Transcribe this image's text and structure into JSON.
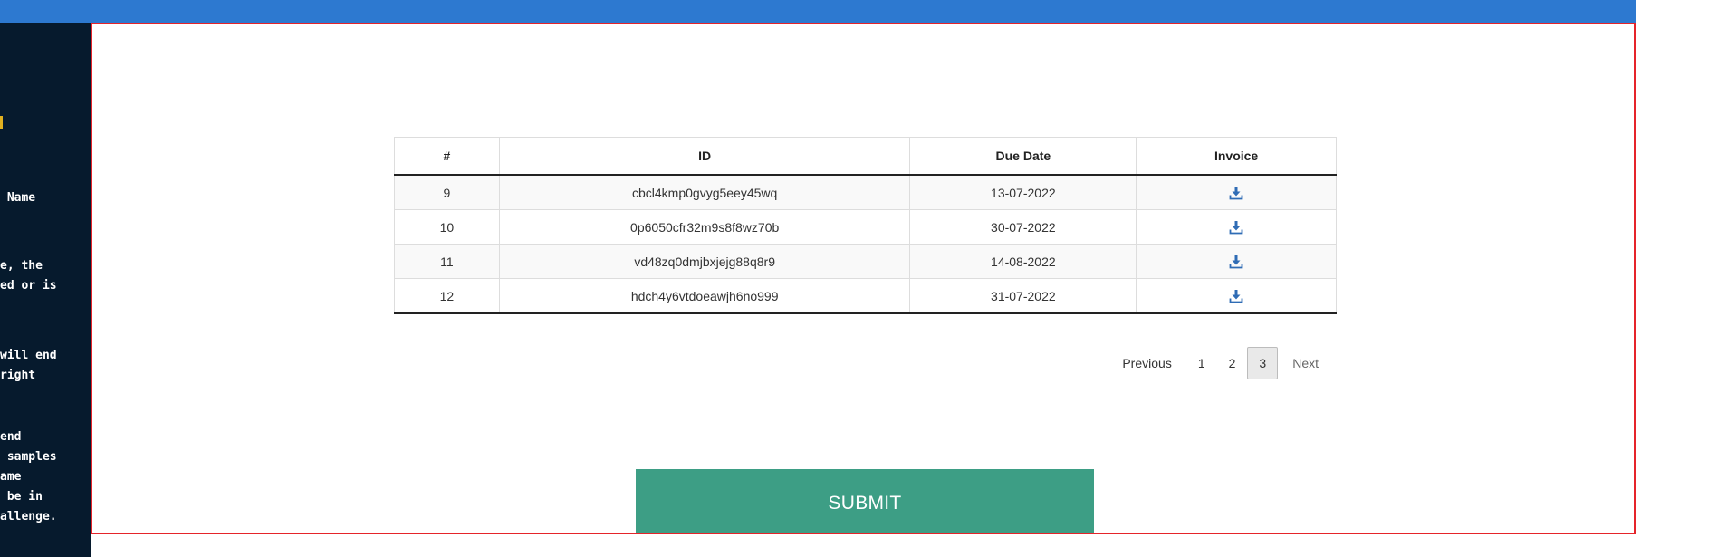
{
  "left_panel": {
    "lines": [
      " Name",
      "e, the",
      "ed or is",
      "will end",
      "right",
      "end",
      " samples",
      "ame",
      " be in",
      "allenge."
    ]
  },
  "table": {
    "headers": [
      "#",
      "ID",
      "Due Date",
      "Invoice"
    ],
    "rows": [
      {
        "num": "9",
        "id": "cbcl4kmp0gvyg5eey45wq",
        "due": "13-07-2022"
      },
      {
        "num": "10",
        "id": "0p6050cfr32m9s8f8wz70b",
        "due": "30-07-2022"
      },
      {
        "num": "11",
        "id": "vd48zq0dmjbxjejg88q8r9",
        "due": "14-08-2022"
      },
      {
        "num": "12",
        "id": "hdch4y6vtdoeawjh6no999",
        "due": "31-07-2022"
      }
    ],
    "invoice_icon": "download-icon"
  },
  "pagination": {
    "previous": "Previous",
    "pages": [
      "1",
      "2",
      "3"
    ],
    "current": "3",
    "next": "Next"
  },
  "submit": {
    "label": "SUBMIT"
  },
  "colors": {
    "topbar": "#2d79d0",
    "left_panel": "#061a2d",
    "frame_border": "#e5242a",
    "submit": "#3d9e85",
    "icon": "#2f6cb5"
  }
}
